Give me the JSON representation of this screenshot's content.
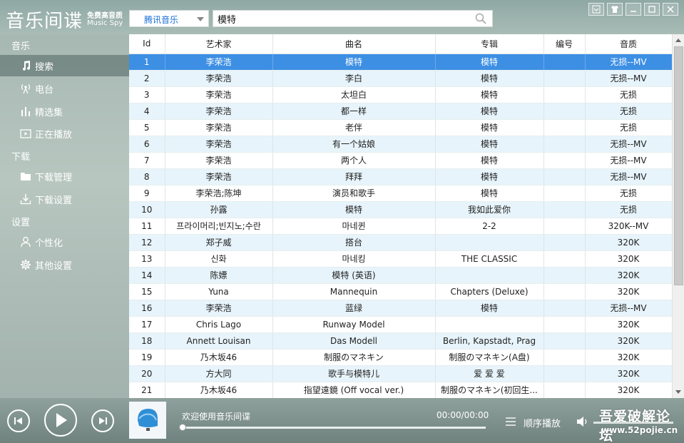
{
  "app": {
    "title": "音乐间谍",
    "subtitle_cn": "免费高音质",
    "subtitle_en": "Music Spy"
  },
  "header": {
    "source_value": "腾讯音乐",
    "search_value": "模特",
    "search_placeholder": ""
  },
  "sidebar": {
    "sections": [
      {
        "label": "音乐"
      },
      {
        "label": "下载"
      },
      {
        "label": "设置"
      }
    ],
    "items": [
      {
        "label": "搜索",
        "icon": "music-note-icon",
        "active": true
      },
      {
        "label": "电台",
        "icon": "radio-icon",
        "active": false
      },
      {
        "label": "精选集",
        "icon": "bars-icon",
        "active": false
      },
      {
        "label": "正在播放",
        "icon": "play-screen-icon",
        "active": false
      },
      {
        "label": "下载管理",
        "icon": "folder-icon",
        "active": false
      },
      {
        "label": "下载设置",
        "icon": "download-icon",
        "active": false
      },
      {
        "label": "个性化",
        "icon": "user-icon",
        "active": false
      },
      {
        "label": "其他设置",
        "icon": "gear-icon",
        "active": false
      }
    ]
  },
  "table": {
    "columns": [
      "Id",
      "艺术家",
      "曲名",
      "专辑",
      "编号",
      "音质"
    ],
    "selected_row": 0,
    "rows": [
      [
        "1",
        "李荣浩",
        "模特",
        "模特",
        "",
        "无损--MV"
      ],
      [
        "2",
        "李荣浩",
        "李白",
        "模特",
        "",
        "无损--MV"
      ],
      [
        "3",
        "李荣浩",
        "太坦白",
        "模特",
        "",
        "无损"
      ],
      [
        "4",
        "李荣浩",
        "都一样",
        "模特",
        "",
        "无损"
      ],
      [
        "5",
        "李荣浩",
        "老伴",
        "模特",
        "",
        "无损"
      ],
      [
        "6",
        "李荣浩",
        "有一个姑娘",
        "模特",
        "",
        "无损--MV"
      ],
      [
        "7",
        "李荣浩",
        "两个人",
        "模特",
        "",
        "无损--MV"
      ],
      [
        "8",
        "李荣浩",
        "拜拜",
        "模特",
        "",
        "无损--MV"
      ],
      [
        "9",
        "李荣浩;陈坤",
        "演员和歌手",
        "模特",
        "",
        "无损"
      ],
      [
        "10",
        "孙露",
        "模特",
        "我如此爱你",
        "",
        "无损"
      ],
      [
        "11",
        "프라이머리;빈지노;수란",
        "마네퀸",
        "2-2",
        "",
        "320K--MV"
      ],
      [
        "12",
        "郑子威",
        "搭台",
        "",
        "",
        "320K"
      ],
      [
        "13",
        "신화",
        "마네킹",
        "THE CLASSIC",
        "",
        "320K"
      ],
      [
        "14",
        "陈嫖",
        "模特 (英语)",
        "",
        "",
        "320K"
      ],
      [
        "15",
        "Yuna",
        "Mannequin",
        "Chapters (Deluxe)",
        "",
        "320K"
      ],
      [
        "16",
        "李荣浩",
        "蓝绿",
        "模特",
        "",
        "无损--MV"
      ],
      [
        "17",
        "Chris Lago",
        "Runway Model",
        "",
        "",
        "320K"
      ],
      [
        "18",
        "Annett Louisan",
        "Das Modell",
        "Berlin, Kapstadt, Prag",
        "",
        "320K"
      ],
      [
        "19",
        "乃木坂46",
        "制服のマネキン",
        "制服のマネキン(A盘)",
        "",
        "320K"
      ],
      [
        "20",
        "方大同",
        "歌手与模特儿",
        "爱 爱 爱",
        "",
        "320K"
      ],
      [
        "21",
        "乃木坂46",
        "指望遠鏡 (Off vocal ver.)",
        "制服のマネキン(初回生...",
        "",
        "320K"
      ]
    ]
  },
  "player": {
    "welcome": "欢迎使用音乐间谍",
    "time": "00:00/00:00",
    "progress": 0,
    "order_label": "顺序播放"
  },
  "watermark": {
    "line1": "吾爱破解论坛",
    "line2": "www.52pojie.cn"
  },
  "colors": {
    "selected_row": "#3d8fe4",
    "even_row": "#e7f4fb",
    "source_text": "#1a6fd6"
  }
}
